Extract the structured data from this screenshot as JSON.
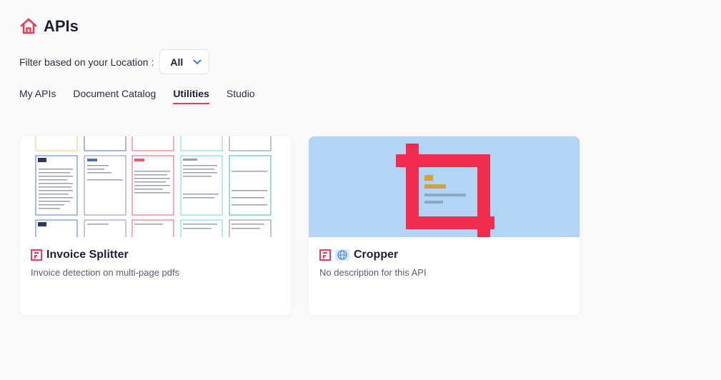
{
  "header": {
    "title": "APIs",
    "icon": "home-icon",
    "icon_color": "#ef3b56"
  },
  "filter": {
    "label": "Filter based on your Location :",
    "value": "All"
  },
  "tabs": [
    {
      "label": "My APIs",
      "active": false
    },
    {
      "label": "Document Catalog",
      "active": false
    },
    {
      "label": "Utilities",
      "active": true
    },
    {
      "label": "Studio",
      "active": false
    }
  ],
  "cards": [
    {
      "title": "Invoice Splitter",
      "description": "Invoice detection on multi-page pdfs",
      "icons": [
        "api-doc-icon"
      ]
    },
    {
      "title": "Cropper",
      "description": "No description for this API",
      "icons": [
        "api-doc-icon",
        "globe-icon"
      ]
    }
  ],
  "colors": {
    "accent": "#ef3b56",
    "cropper_bg": "#b4d4f5",
    "globe": "#4a8fe0"
  }
}
